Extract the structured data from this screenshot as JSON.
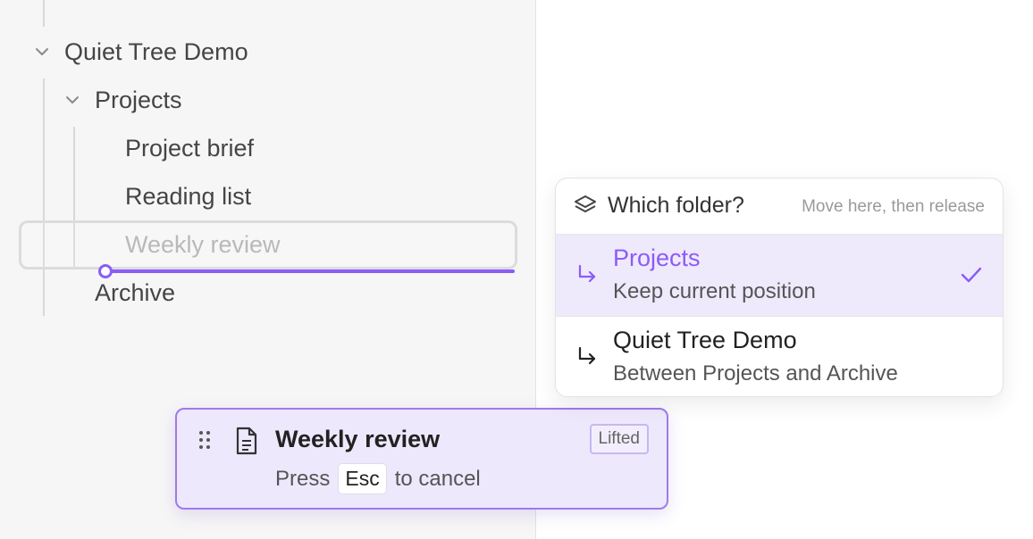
{
  "tree": {
    "root": {
      "label": "Quiet Tree Demo",
      "expanded": true
    },
    "projects": {
      "label": "Projects",
      "expanded": true
    },
    "items": [
      {
        "label": "Project brief"
      },
      {
        "label": "Reading list"
      }
    ],
    "ghost": {
      "label": "Weekly review"
    },
    "archive": {
      "label": "Archive"
    }
  },
  "drag_card": {
    "title": "Weekly review",
    "badge": "Lifted",
    "hint_before": "Press",
    "hint_key": "Esc",
    "hint_after": "to cancel"
  },
  "folder_popup": {
    "title": "Which folder?",
    "hint": "Move here, then release",
    "options": [
      {
        "title": "Projects",
        "subtitle": "Keep current position",
        "selected": true
      },
      {
        "title": "Quiet Tree Demo",
        "subtitle": "Between Projects and Archive",
        "selected": false
      }
    ]
  },
  "colors": {
    "accent": "#8b5cf6",
    "accent_bg": "#efe9fc",
    "sidebar_bg": "#f6f6f6"
  }
}
